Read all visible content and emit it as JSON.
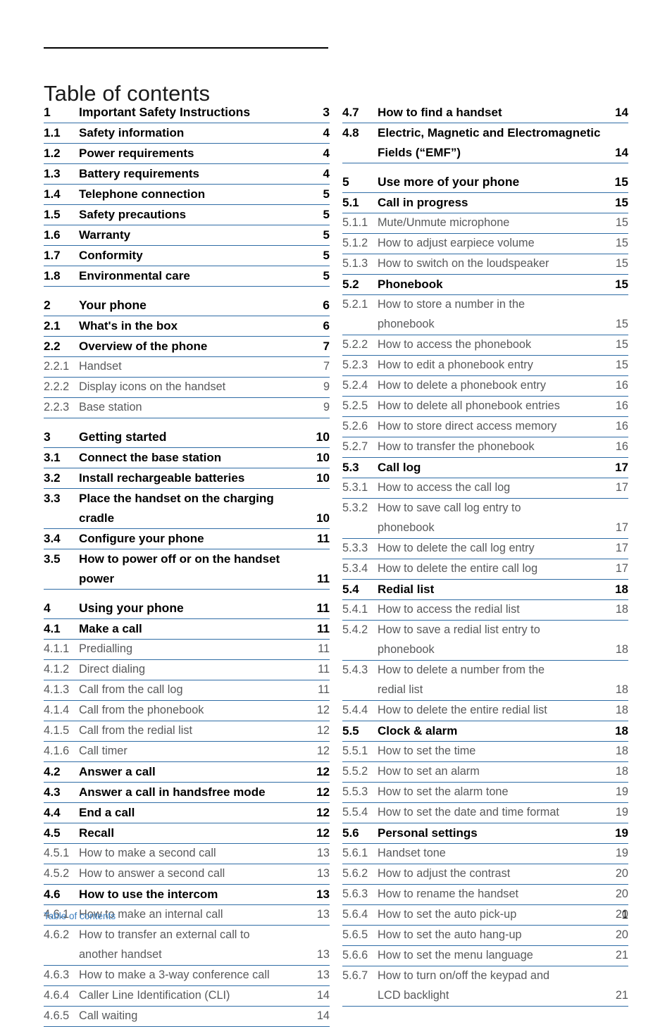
{
  "document": {
    "title": "Table of contents",
    "footer_label": "Table of contents",
    "page_number": "1",
    "rule_color": "#2f6ca5",
    "footer_link_color": "#3a7ec0",
    "level3_text_color": "#58595b"
  },
  "columns": [
    {
      "name": "left",
      "entries": [
        {
          "level": 1,
          "number": "1",
          "title": "Important Safety Instructions",
          "page": "3",
          "spaced": false
        },
        {
          "level": 2,
          "number": "1.1",
          "title": "Safety information",
          "page": "4",
          "spaced": false
        },
        {
          "level": 2,
          "number": "1.2",
          "title": "Power requirements",
          "page": "4",
          "spaced": false
        },
        {
          "level": 2,
          "number": "1.3",
          "title": "Battery requirements",
          "page": "4",
          "spaced": false
        },
        {
          "level": 2,
          "number": "1.4",
          "title": "Telephone connection",
          "page": "5",
          "spaced": false
        },
        {
          "level": 2,
          "number": "1.5",
          "title": "Safety precautions",
          "page": "5",
          "spaced": false
        },
        {
          "level": 2,
          "number": "1.6",
          "title": "Warranty",
          "page": "5",
          "spaced": false
        },
        {
          "level": 2,
          "number": "1.7",
          "title": "Conformity",
          "page": "5",
          "spaced": false
        },
        {
          "level": 2,
          "number": "1.8",
          "title": "Environmental care",
          "page": "5",
          "spaced": false
        },
        {
          "level": 1,
          "number": "2",
          "title": "Your phone",
          "page": "6",
          "spaced": true
        },
        {
          "level": 2,
          "number": "2.1",
          "title": "What's in the box",
          "page": "6",
          "spaced": false
        },
        {
          "level": 2,
          "number": "2.2",
          "title": "Overview of the phone",
          "page": "7",
          "spaced": false
        },
        {
          "level": 3,
          "number": "2.2.1",
          "title": "Handset",
          "page": "7",
          "spaced": false
        },
        {
          "level": 3,
          "number": "2.2.2",
          "title": "Display icons on the handset",
          "page": "9",
          "spaced": false
        },
        {
          "level": 3,
          "number": "2.2.3",
          "title": "Base station",
          "page": "9",
          "spaced": false
        },
        {
          "level": 1,
          "number": "3",
          "title": "Getting started",
          "page": "10",
          "spaced": true
        },
        {
          "level": 2,
          "number": "3.1",
          "title": "Connect the base station",
          "page": "10",
          "spaced": false
        },
        {
          "level": 2,
          "number": "3.2",
          "title": "Install rechargeable batteries",
          "page": "10",
          "spaced": false
        },
        {
          "level": 2,
          "number": "3.3",
          "title": "Place the handset on the charging",
          "title2": "cradle",
          "page": "10",
          "spaced": false
        },
        {
          "level": 2,
          "number": "3.4",
          "title": "Configure your phone",
          "page": "11",
          "spaced": false
        },
        {
          "level": 2,
          "number": "3.5",
          "title": "How to power off or on the handset",
          "title2": "power",
          "page": "11",
          "spaced": false
        },
        {
          "level": 1,
          "number": "4",
          "title": "Using your phone",
          "page": "11",
          "spaced": true
        },
        {
          "level": 2,
          "number": "4.1",
          "title": "Make a call",
          "page": "11",
          "spaced": false
        },
        {
          "level": 3,
          "number": "4.1.1",
          "title": "Predialling",
          "page": "11",
          "spaced": false
        },
        {
          "level": 3,
          "number": "4.1.2",
          "title": "Direct dialing",
          "page": "11",
          "spaced": false
        },
        {
          "level": 3,
          "number": "4.1.3",
          "title": "Call from the call log",
          "page": "11",
          "spaced": false
        },
        {
          "level": 3,
          "number": "4.1.4",
          "title": "Call from the phonebook",
          "page": "12",
          "spaced": false
        },
        {
          "level": 3,
          "number": "4.1.5",
          "title": "Call from the redial list",
          "page": "12",
          "spaced": false
        },
        {
          "level": 3,
          "number": "4.1.6",
          "title": "Call timer",
          "page": "12",
          "spaced": false
        },
        {
          "level": 2,
          "number": "4.2",
          "title": "Answer a call",
          "page": "12",
          "spaced": false
        },
        {
          "level": 2,
          "number": "4.3",
          "title": "Answer a call in handsfree mode",
          "page": "12",
          "spaced": false
        },
        {
          "level": 2,
          "number": "4.4",
          "title": "End a call",
          "page": "12",
          "spaced": false
        },
        {
          "level": 2,
          "number": "4.5",
          "title": "Recall",
          "page": "12",
          "spaced": false
        },
        {
          "level": 3,
          "number": "4.5.1",
          "title": "How to make a second call",
          "page": "13",
          "spaced": false
        },
        {
          "level": 3,
          "number": "4.5.2",
          "title": "How to answer a second call",
          "page": "13",
          "spaced": false
        },
        {
          "level": 2,
          "number": "4.6",
          "title": "How to use the intercom",
          "page": "13",
          "spaced": false
        },
        {
          "level": 3,
          "number": "4.6.1",
          "title": "How to make an internal call",
          "page": "13",
          "spaced": false
        },
        {
          "level": 3,
          "number": "4.6.2",
          "title": "How to transfer an external call to",
          "title2": "another handset",
          "page": "13",
          "spaced": false
        },
        {
          "level": 3,
          "number": "4.6.3",
          "title": "How to make a 3-way conference call",
          "page": "13",
          "spaced": false
        },
        {
          "level": 3,
          "number": "4.6.4",
          "title": "Caller Line Identification (CLI)",
          "page": "14",
          "spaced": false
        },
        {
          "level": 3,
          "number": "4.6.5",
          "title": "Call waiting",
          "page": "14",
          "spaced": false
        }
      ]
    },
    {
      "name": "right",
      "entries": [
        {
          "level": 2,
          "number": "4.7",
          "title": "How to find a handset",
          "page": "14",
          "spaced": false
        },
        {
          "level": 2,
          "number": "4.8",
          "title": "Electric, Magnetic and Electromagnetic",
          "title2": "Fields (“EMF”)",
          "page": "14",
          "spaced": false
        },
        {
          "level": 1,
          "number": "5",
          "title": "Use more of your phone",
          "page": "15",
          "spaced": true
        },
        {
          "level": 2,
          "number": "5.1",
          "title": "Call in progress",
          "page": "15",
          "spaced": false
        },
        {
          "level": 3,
          "number": "5.1.1",
          "title": "Mute/Unmute microphone",
          "page": "15",
          "spaced": false
        },
        {
          "level": 3,
          "number": "5.1.2",
          "title": "How to adjust earpiece volume",
          "page": "15",
          "spaced": false
        },
        {
          "level": 3,
          "number": "5.1.3",
          "title": "How to switch on the loudspeaker",
          "page": "15",
          "spaced": false
        },
        {
          "level": 2,
          "number": "5.2",
          "title": "Phonebook",
          "page": "15",
          "spaced": false
        },
        {
          "level": 3,
          "number": "5.2.1",
          "title": "How to store a number in the",
          "title2": "phonebook",
          "page": "15",
          "spaced": false
        },
        {
          "level": 3,
          "number": "5.2.2",
          "title": "How to access the phonebook",
          "page": "15",
          "spaced": false
        },
        {
          "level": 3,
          "number": "5.2.3",
          "title": "How to edit a phonebook entry",
          "page": "15",
          "spaced": false
        },
        {
          "level": 3,
          "number": "5.2.4",
          "title": "How to delete a phonebook entry",
          "page": "16",
          "spaced": false
        },
        {
          "level": 3,
          "number": "5.2.5",
          "title": "How to delete all phonebook entries",
          "page": "16",
          "spaced": false
        },
        {
          "level": 3,
          "number": "5.2.6",
          "title": "How to store direct access memory",
          "page": "16",
          "spaced": false
        },
        {
          "level": 3,
          "number": "5.2.7",
          "title": "How to transfer the phonebook",
          "page": "16",
          "spaced": false
        },
        {
          "level": 2,
          "number": "5.3",
          "title": "Call log",
          "page": "17",
          "spaced": false
        },
        {
          "level": 3,
          "number": "5.3.1",
          "title": "How to access the call log",
          "page": "17",
          "spaced": false
        },
        {
          "level": 3,
          "number": "5.3.2",
          "title": "How to save call log entry to",
          "title2": "phonebook",
          "page": "17",
          "spaced": false
        },
        {
          "level": 3,
          "number": "5.3.3",
          "title": "How to delete the call log entry",
          "page": "17",
          "spaced": false
        },
        {
          "level": 3,
          "number": "5.3.4",
          "title": "How to delete the entire call log",
          "page": "17",
          "spaced": false
        },
        {
          "level": 2,
          "number": "5.4",
          "title": "Redial list",
          "page": "18",
          "spaced": false
        },
        {
          "level": 3,
          "number": "5.4.1",
          "title": "How to access the redial list",
          "page": "18",
          "spaced": false
        },
        {
          "level": 3,
          "number": "5.4.2",
          "title": "How to save a redial list entry to",
          "title2": "phonebook",
          "page": "18",
          "spaced": false
        },
        {
          "level": 3,
          "number": "5.4.3",
          "title": "How to delete a number from the",
          "title2": "redial list",
          "page": "18",
          "spaced": false
        },
        {
          "level": 3,
          "number": "5.4.4",
          "title": "How to delete the entire redial list",
          "page": "18",
          "spaced": false
        },
        {
          "level": 2,
          "number": "5.5",
          "title": "Clock & alarm",
          "page": "18",
          "spaced": false
        },
        {
          "level": 3,
          "number": "5.5.1",
          "title": "How to set the time",
          "page": "18",
          "spaced": false
        },
        {
          "level": 3,
          "number": "5.5.2",
          "title": "How to set an alarm",
          "page": "18",
          "spaced": false
        },
        {
          "level": 3,
          "number": "5.5.3",
          "title": "How to set the alarm tone",
          "page": "19",
          "spaced": false
        },
        {
          "level": 3,
          "number": "5.5.4",
          "title": "How to set the date and time format",
          "page": "19",
          "spaced": false
        },
        {
          "level": 2,
          "number": "5.6",
          "title": "Personal settings",
          "page": "19",
          "spaced": false
        },
        {
          "level": 3,
          "number": "5.6.1",
          "title": "Handset tone",
          "page": "19",
          "spaced": false
        },
        {
          "level": 3,
          "number": "5.6.2",
          "title": "How to adjust the contrast",
          "page": "20",
          "spaced": false
        },
        {
          "level": 3,
          "number": "5.6.3",
          "title": "How to rename the handset",
          "page": "20",
          "spaced": false
        },
        {
          "level": 3,
          "number": "5.6.4",
          "title": "How to set the auto pick-up",
          "page": "20",
          "spaced": false
        },
        {
          "level": 3,
          "number": "5.6.5",
          "title": "How to set the auto hang-up",
          "page": "20",
          "spaced": false
        },
        {
          "level": 3,
          "number": "5.6.6",
          "title": "How to set the menu language",
          "page": "21",
          "spaced": false
        },
        {
          "level": 3,
          "number": "5.6.7",
          "title": "How to turn on/off the keypad and",
          "title2": "LCD backlight",
          "page": "21",
          "spaced": false
        }
      ]
    }
  ]
}
